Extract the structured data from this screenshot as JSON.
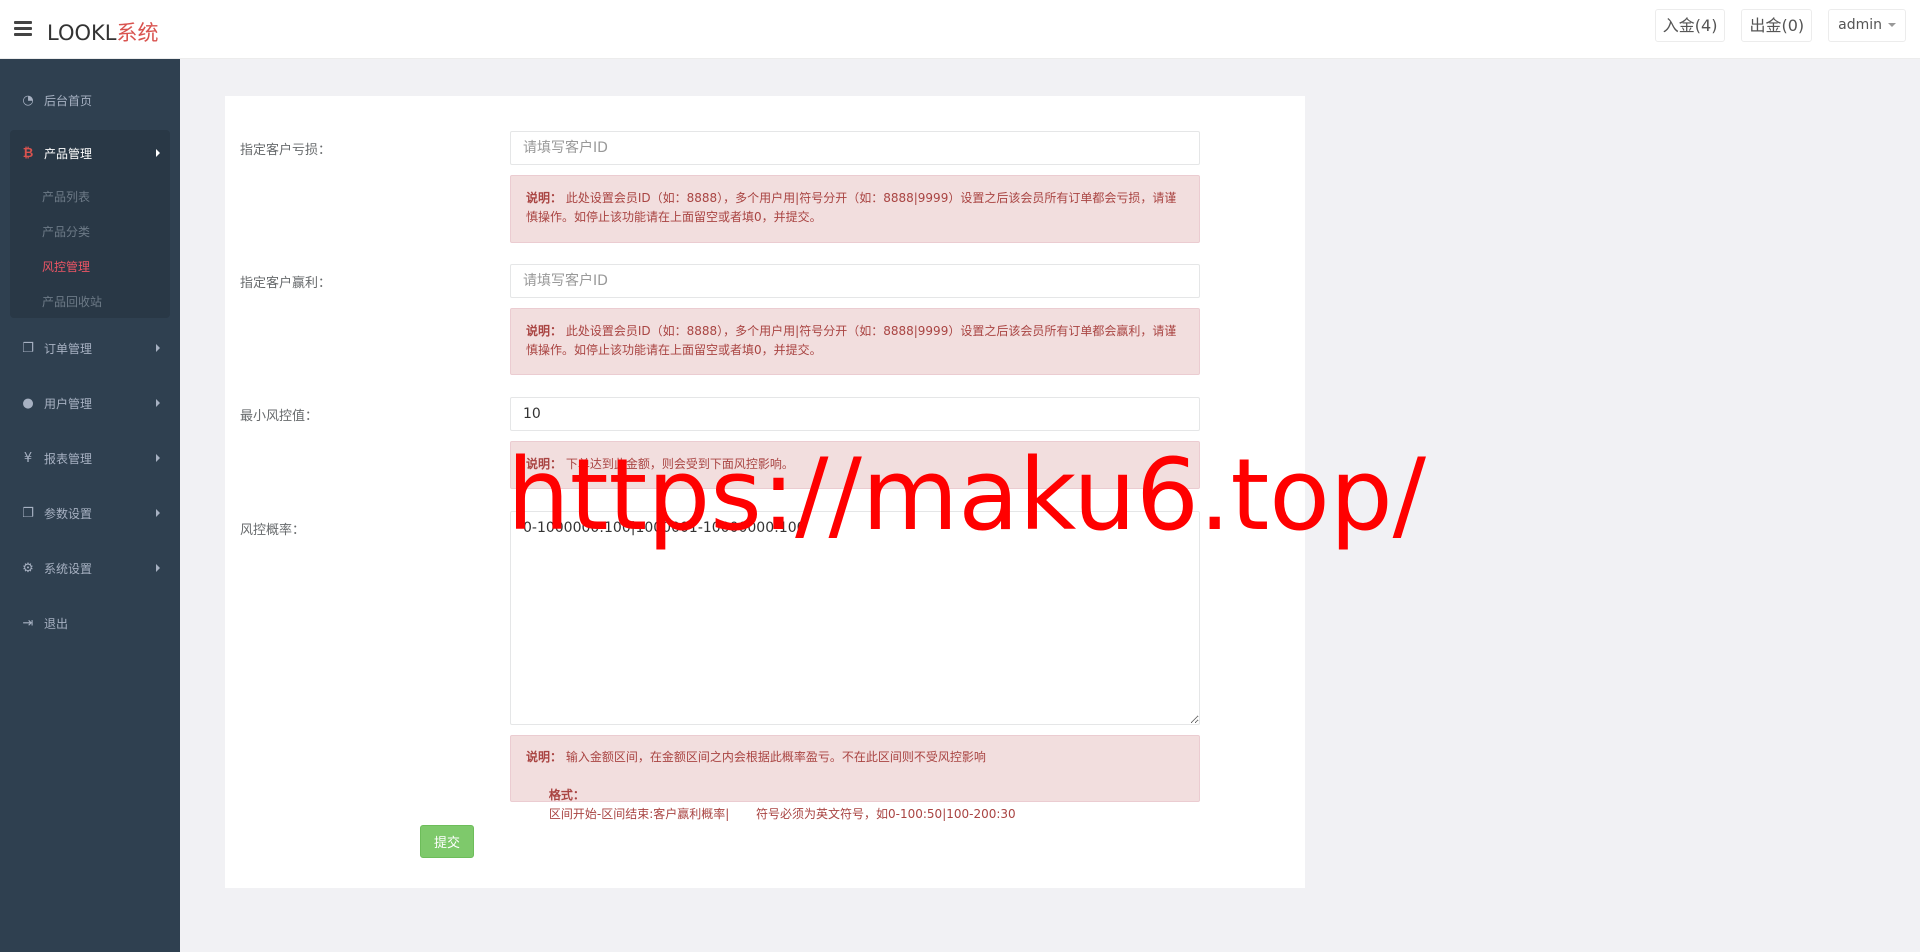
{
  "header": {
    "logo_main": "LOOKL",
    "logo_accent": "系统",
    "deposit_label": "入金(4)",
    "withdraw_label": "出金(0)",
    "user_label": "admin"
  },
  "sidebar": {
    "home": "后台首页",
    "product": {
      "label": "产品管理",
      "items": [
        "产品列表",
        "产品分类",
        "风控管理",
        "产品回收站"
      ]
    },
    "orders": "订单管理",
    "users": "用户管理",
    "reports": "报表管理",
    "params": "参数设置",
    "system": "系统设置",
    "logout": "退出"
  },
  "form": {
    "loss": {
      "label": "指定客户亏损：",
      "placeholder": "请填写客户ID",
      "note_title": "说明：",
      "note_text": "此处设置会员ID（如：8888），多个用户用|符号分开（如：8888|9999）设置之后该会员所有订单都会亏损，请谨慎操作。如停止该功能请在上面留空或者填0，并提交。"
    },
    "profit": {
      "label": "指定客户赢利：",
      "placeholder": "请填写客户ID",
      "note_title": "说明：",
      "note_text": "此处设置会员ID（如：8888），多个用户用|符号分开（如：8888|9999）设置之后该会员所有订单都会赢利，请谨慎操作。如停止该功能请在上面留空或者填0，并提交。"
    },
    "min_risk": {
      "label": "最小风控值：",
      "value": "10",
      "note_title": "说明：",
      "note_text": "下单达到此金额，则会受到下面风控影响。"
    },
    "risk_rate": {
      "label": "风控概率：",
      "value": "0-1000000:100|1000001-10000000:100",
      "note_title": "说明：",
      "note_text": "输入金额区间，在金额区间之内会根据此概率盈亏。不在此区间则不受风控影响",
      "format_title": "格式：",
      "format_text": "区间开始-区间结束:客户赢利概率|       符号必须为英文符号，如0-100:50|100-200:30"
    },
    "submit_label": "提交"
  },
  "watermark": "https://maku6.top/"
}
